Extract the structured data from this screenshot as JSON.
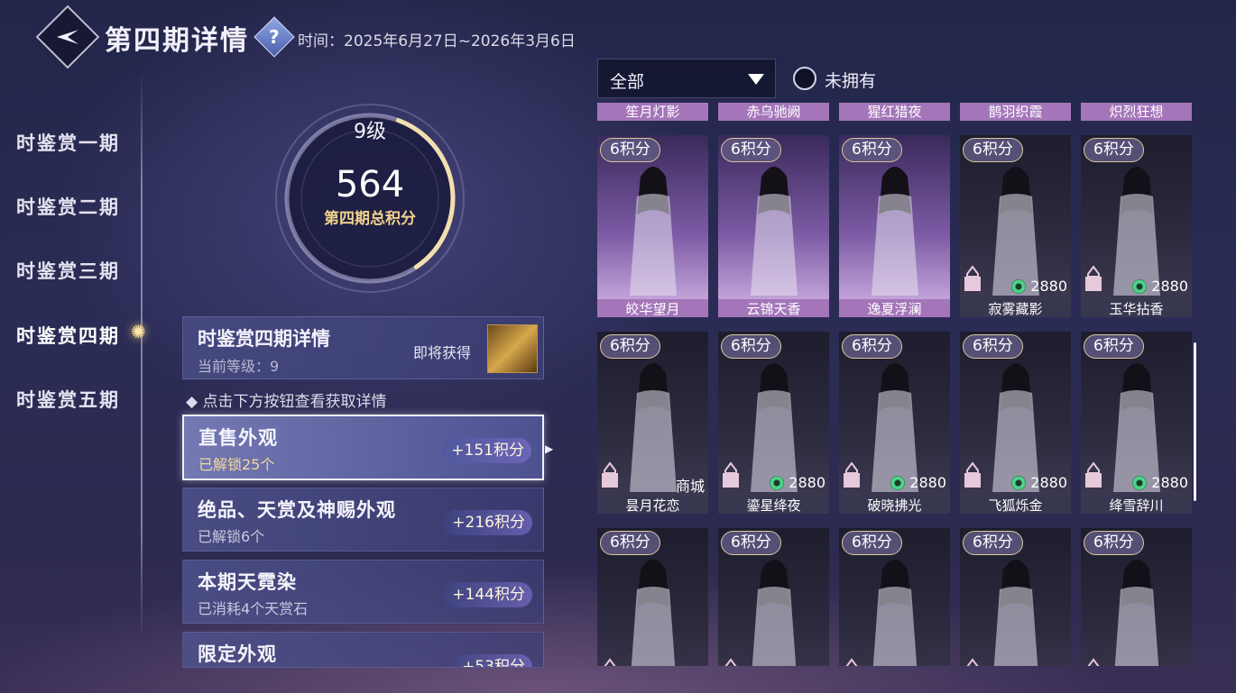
{
  "header": {
    "title": "第四期详情",
    "help_symbol": "?",
    "period": "时间：2025年6月27日~2026年3月6日"
  },
  "nav": {
    "items": [
      {
        "label": "时鉴赏一期",
        "active": false
      },
      {
        "label": "时鉴赏二期",
        "active": false
      },
      {
        "label": "时鉴赏三期",
        "active": false
      },
      {
        "label": "时鉴赏四期",
        "active": true
      },
      {
        "label": "时鉴赏五期",
        "active": false
      }
    ]
  },
  "ring": {
    "level": "9级",
    "score": "564",
    "score_label": "第四期总积分",
    "progress": 0.35
  },
  "detail": {
    "title": "时鉴赏四期详情",
    "current_level": "当前等级：9",
    "soon": "即将获得"
  },
  "hint": "点击下方按钮查看获取详情",
  "categories": [
    {
      "title": "直售外观",
      "sub": "已解锁25个",
      "points": "+151积分",
      "selected": true
    },
    {
      "title": "绝品、天赏及神赐外观",
      "sub": "已解锁6个",
      "points": "+216积分",
      "selected": false
    },
    {
      "title": "本期天霓染",
      "sub": "已消耗4个天赏石",
      "points": "+144积分",
      "selected": false
    },
    {
      "title": "限定外观",
      "sub": "",
      "points": "+53积分",
      "selected": false
    }
  ],
  "filter": {
    "selected": "全部",
    "toggle_label": "未拥有"
  },
  "top_row_names": [
    "笙月灯影",
    "赤乌驰阙",
    "猩红猎夜",
    "鹊羽织霞",
    "炽烈狂想"
  ],
  "rows": [
    [
      {
        "badge": "6积分",
        "name": "皎华望月",
        "style": "purple",
        "price": "",
        "shop": "",
        "locked": false
      },
      {
        "badge": "6积分",
        "name": "云锦天香",
        "style": "purple",
        "price": "",
        "shop": "",
        "locked": false
      },
      {
        "badge": "6积分",
        "name": "逸夏浮澜",
        "style": "purple",
        "price": "",
        "shop": "",
        "locked": false
      },
      {
        "badge": "6积分",
        "name": "寂雾藏影",
        "style": "dark",
        "price": "2880",
        "shop": "",
        "locked": true
      },
      {
        "badge": "6积分",
        "name": "玉华拈香",
        "style": "dark",
        "price": "2880",
        "shop": "",
        "locked": true
      }
    ],
    [
      {
        "badge": "6积分",
        "name": "昙月花恋",
        "style": "dark",
        "price": "",
        "shop": "商城",
        "locked": true
      },
      {
        "badge": "6积分",
        "name": "鎏星绛夜",
        "style": "dark",
        "price": "2880",
        "shop": "",
        "locked": true
      },
      {
        "badge": "6积分",
        "name": "破晓拂光",
        "style": "dark",
        "price": "2880",
        "shop": "",
        "locked": true
      },
      {
        "badge": "6积分",
        "name": "飞狐烁金",
        "style": "dark",
        "price": "2880",
        "shop": "",
        "locked": true
      },
      {
        "badge": "6积分",
        "name": "绛雪辞川",
        "style": "dark",
        "price": "2880",
        "shop": "",
        "locked": true
      }
    ],
    [
      {
        "badge": "6积分",
        "name": "",
        "style": "dark",
        "price": "",
        "shop": "",
        "locked": true
      },
      {
        "badge": "6积分",
        "name": "",
        "style": "dark",
        "price": "",
        "shop": "",
        "locked": true
      },
      {
        "badge": "6积分",
        "name": "",
        "style": "dark",
        "price": "",
        "shop": "",
        "locked": true
      },
      {
        "badge": "6积分",
        "name": "",
        "style": "dark",
        "price": "",
        "shop": "",
        "locked": true
      },
      {
        "badge": "6积分",
        "name": "",
        "style": "dark",
        "price": "",
        "shop": "",
        "locked": true
      }
    ]
  ],
  "colors": {
    "accent_gold": "#f0d28c",
    "card_purple": "#a475b9",
    "background": "#2a2c55"
  }
}
